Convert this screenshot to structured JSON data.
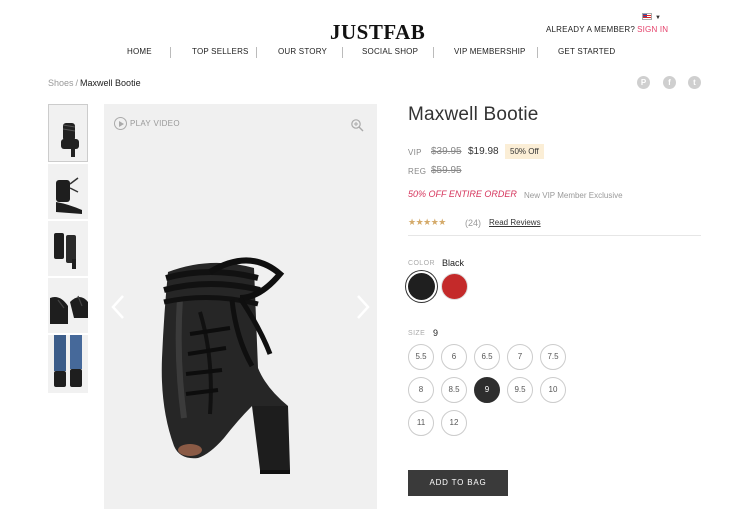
{
  "header": {
    "logo": "JUSTFAB",
    "member_prompt": "ALREADY A MEMBER?",
    "sign_in": "SIGN IN",
    "country_icon": "us-flag-icon",
    "nav": [
      "HOME",
      "TOP SELLERS",
      "OUR STORY",
      "SOCIAL SHOP",
      "VIP MEMBERSHIP",
      "GET STARTED"
    ]
  },
  "breadcrumb": {
    "parent": "Shoes",
    "separator": "/",
    "current": "Maxwell Bootie"
  },
  "share": {
    "icons": [
      "pinterest-icon",
      "facebook-icon",
      "twitter-icon"
    ],
    "glyphs": [
      "P",
      "f",
      "t"
    ]
  },
  "gallery": {
    "play_video": "PLAY VIDEO",
    "thumbnails": 5,
    "zoom_icon": "zoom-icon"
  },
  "product": {
    "title": "Maxwell Bootie",
    "vip_label": "VIP",
    "vip_old_price": "$39.95",
    "vip_price": "$19.98",
    "discount_badge": "50% Off",
    "reg_label": "REG",
    "reg_price": "$59.95",
    "promo": "50% OFF ENTIRE ORDER",
    "promo_note": "New VIP Member Exclusive",
    "rating": 4.5,
    "stars": "★★★★★",
    "review_count": "(24)",
    "read_reviews": "Read Reviews",
    "color_label": "COLOR",
    "color_value": "Black",
    "colors": [
      {
        "name": "Black",
        "hex": "#1f1f1f"
      },
      {
        "name": "Red",
        "hex": "#c42a2a"
      }
    ],
    "size_label": "SIZE",
    "size_value": "9",
    "sizes": [
      "5.5",
      "6",
      "6.5",
      "7",
      "7.5",
      "8",
      "8.5",
      "9",
      "9.5",
      "10",
      "11",
      "12"
    ],
    "selected_size": "9",
    "add_to_bag": "ADD TO BAG"
  },
  "colors": {
    "accent": "#e5406a",
    "promo": "#d6365d",
    "button": "#3a3a3a",
    "badge": "#fbeed6"
  }
}
